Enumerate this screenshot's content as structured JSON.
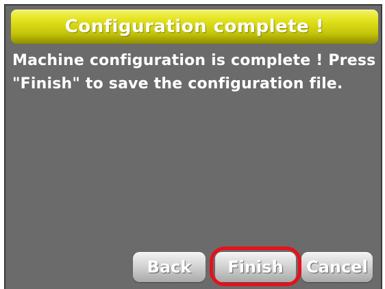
{
  "dialog": {
    "title": "Configuration complete !",
    "message": "Machine configuration is complete ! Press \"Finish\" to save the configuration file."
  },
  "buttons": {
    "back_label": "Back",
    "finish_label": "Finish",
    "cancel_label": "Cancel"
  },
  "colors": {
    "title_bar": "#d6d614",
    "panel_background": "#6b6b6b",
    "highlight_ring": "#e8101a",
    "button_face": "#cfcfcf"
  }
}
